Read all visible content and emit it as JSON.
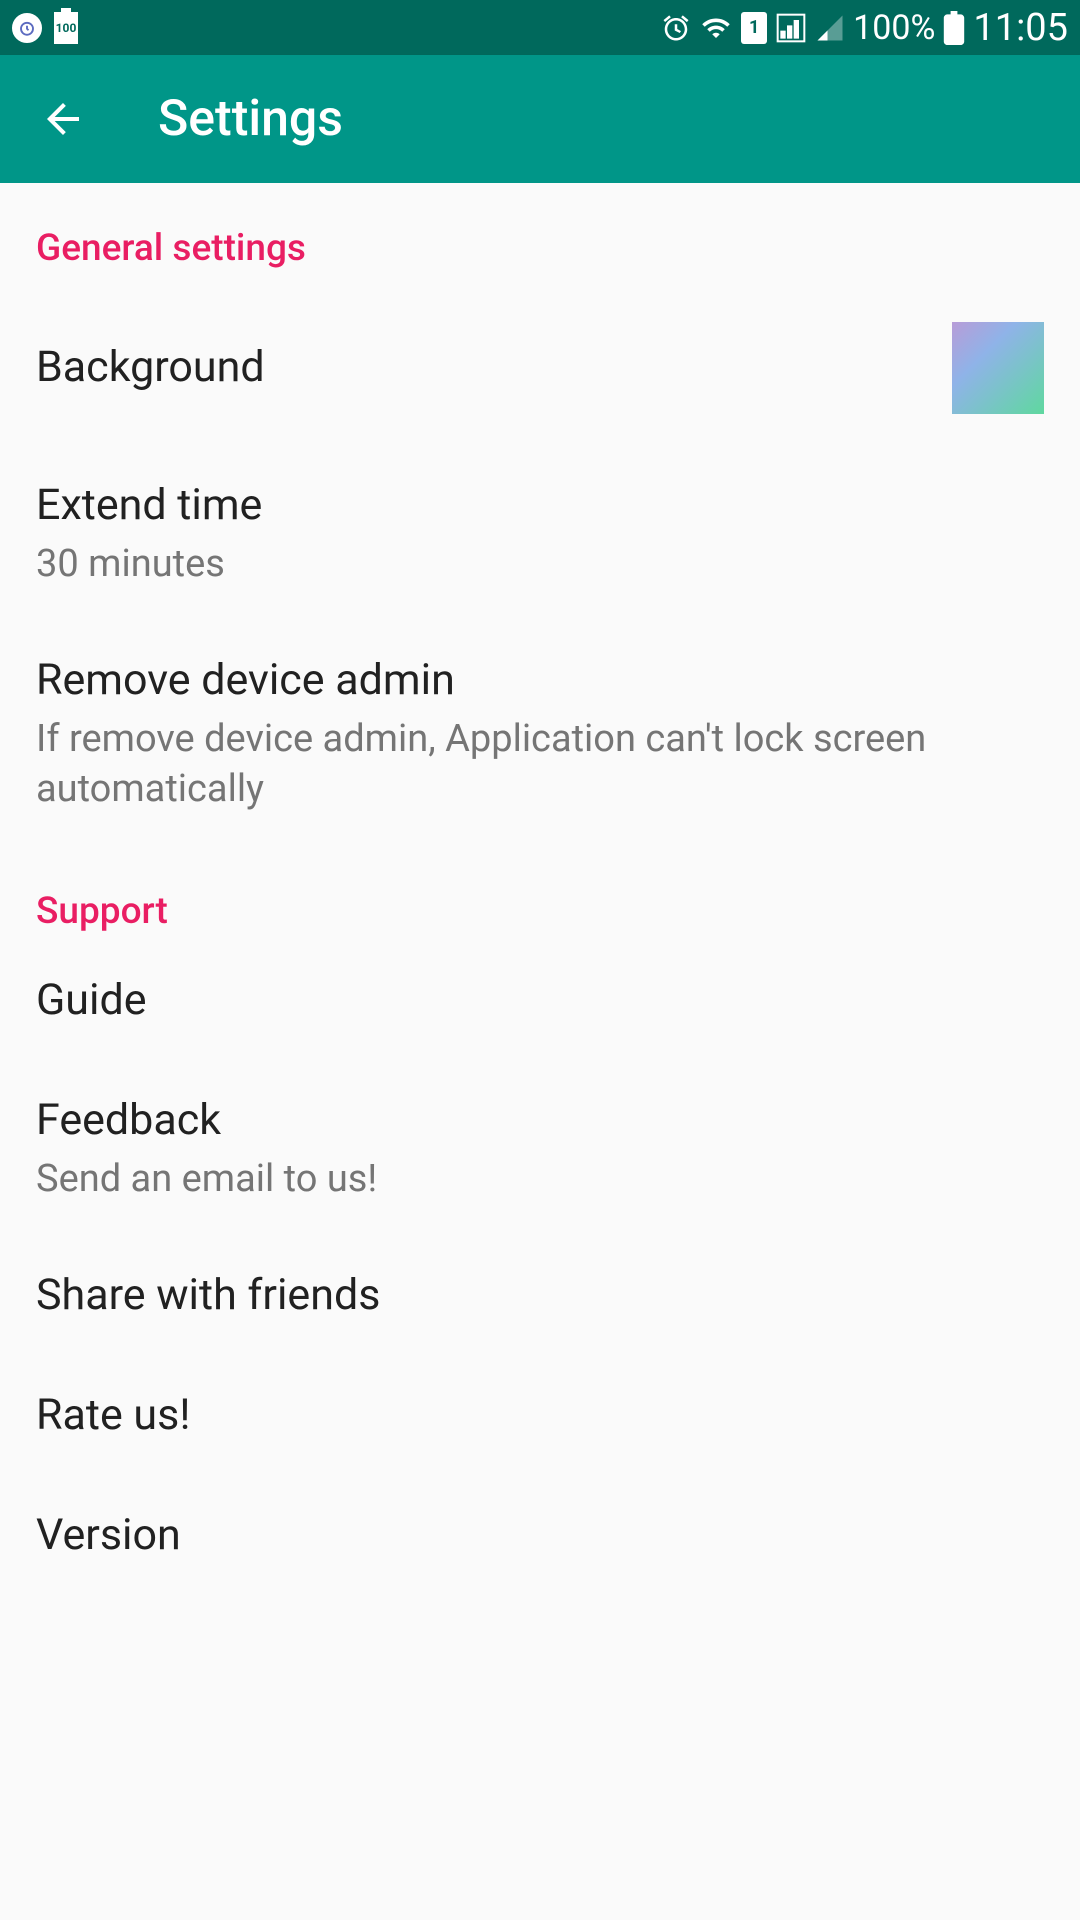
{
  "status_bar": {
    "battery_level": "100",
    "battery_percent": "100%",
    "time": "11:05"
  },
  "app_bar": {
    "title": "Settings"
  },
  "sections": {
    "general": {
      "header": "General settings",
      "background": {
        "title": "Background"
      },
      "extend_time": {
        "title": "Extend time",
        "subtitle": "30 minutes"
      },
      "remove_admin": {
        "title": "Remove device admin",
        "subtitle": "If remove device admin, Application can't lock screen automatically"
      }
    },
    "support": {
      "header": "Support",
      "guide": {
        "title": "Guide"
      },
      "feedback": {
        "title": "Feedback",
        "subtitle": "Send an email to us!"
      },
      "share": {
        "title": "Share with friends"
      },
      "rate": {
        "title": "Rate us!"
      },
      "version": {
        "title": "Version"
      }
    }
  }
}
